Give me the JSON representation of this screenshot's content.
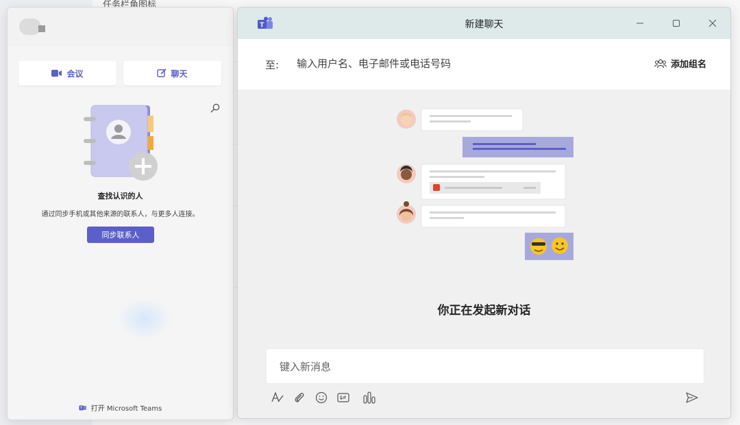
{
  "background": {
    "title": "任务栏角图标"
  },
  "left_panel": {
    "meeting_label": "会议",
    "chat_label": "聊天",
    "find_title": "查找认识的人",
    "find_desc": "通过同步手机或其他来源的联系人，与更多人连接。",
    "sync_button": "同步联系人",
    "open_teams": "打开 Microsoft Teams"
  },
  "chat_window": {
    "title": "新建聊天",
    "to_label": "至:",
    "to_placeholder": "输入用户名、电子邮件或电话号码",
    "add_group": "添加组名",
    "new_conversation": "你正在发起新对话",
    "compose_placeholder": "键入新消息"
  },
  "colors": {
    "accent": "#5b5fc7",
    "titlebar": "#dee9ea"
  },
  "icons": [
    "video-icon",
    "compose-icon",
    "search-icon",
    "teams-logo-icon",
    "minimize-icon",
    "maximize-icon",
    "close-icon",
    "people-add-icon",
    "format-icon",
    "attach-icon",
    "emoji-icon",
    "gif-icon",
    "poll-icon",
    "send-icon"
  ]
}
